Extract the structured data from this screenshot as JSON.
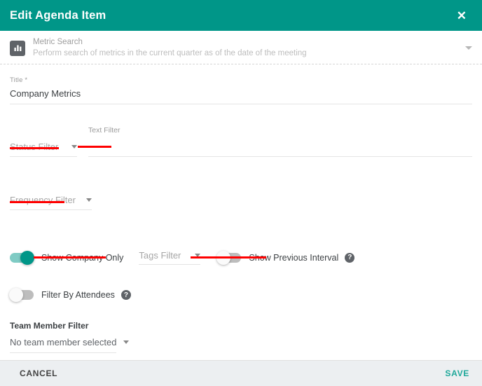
{
  "header": {
    "title": "Edit Agenda Item",
    "close_label": "✕"
  },
  "metric_search": {
    "icon": "bar-chart-icon",
    "title": "Metric Search",
    "subtitle": "Perform search of metrics in the current quarter as of the date of the meeting"
  },
  "title_field": {
    "label": "Title *",
    "value": "Company Metrics",
    "placeholder": ""
  },
  "filters": {
    "status_filter": {
      "placeholder": "Status Filter",
      "value": ""
    },
    "text_filter": {
      "label": "Text Filter",
      "value": "",
      "placeholder": ""
    },
    "frequency_filter": {
      "placeholder": "Frequency Filter",
      "value": ""
    },
    "tags_filter": {
      "placeholder": "Tags Filter",
      "value": ""
    }
  },
  "toggles": {
    "show_company_only": {
      "label": "Show Company Only",
      "state": "on"
    },
    "show_previous_interval": {
      "label": "Show Previous Interval",
      "state": "off",
      "help": "?"
    },
    "filter_by_attendees": {
      "label": "Filter By Attendees",
      "state": "off",
      "help": "?"
    }
  },
  "team_member": {
    "label": "Team Member Filter",
    "selected": "No team member selected"
  },
  "footer": {
    "cancel_label": "CANCEL",
    "save_label": "SAVE"
  },
  "colors": {
    "header_teal": "#009688",
    "toggle_on_track": "#7fcbc4",
    "toggle_on_knob": "#009688",
    "save_teal": "#1fa89a",
    "footer_bg": "#eceff1",
    "annotation_red": "#ff0000"
  }
}
